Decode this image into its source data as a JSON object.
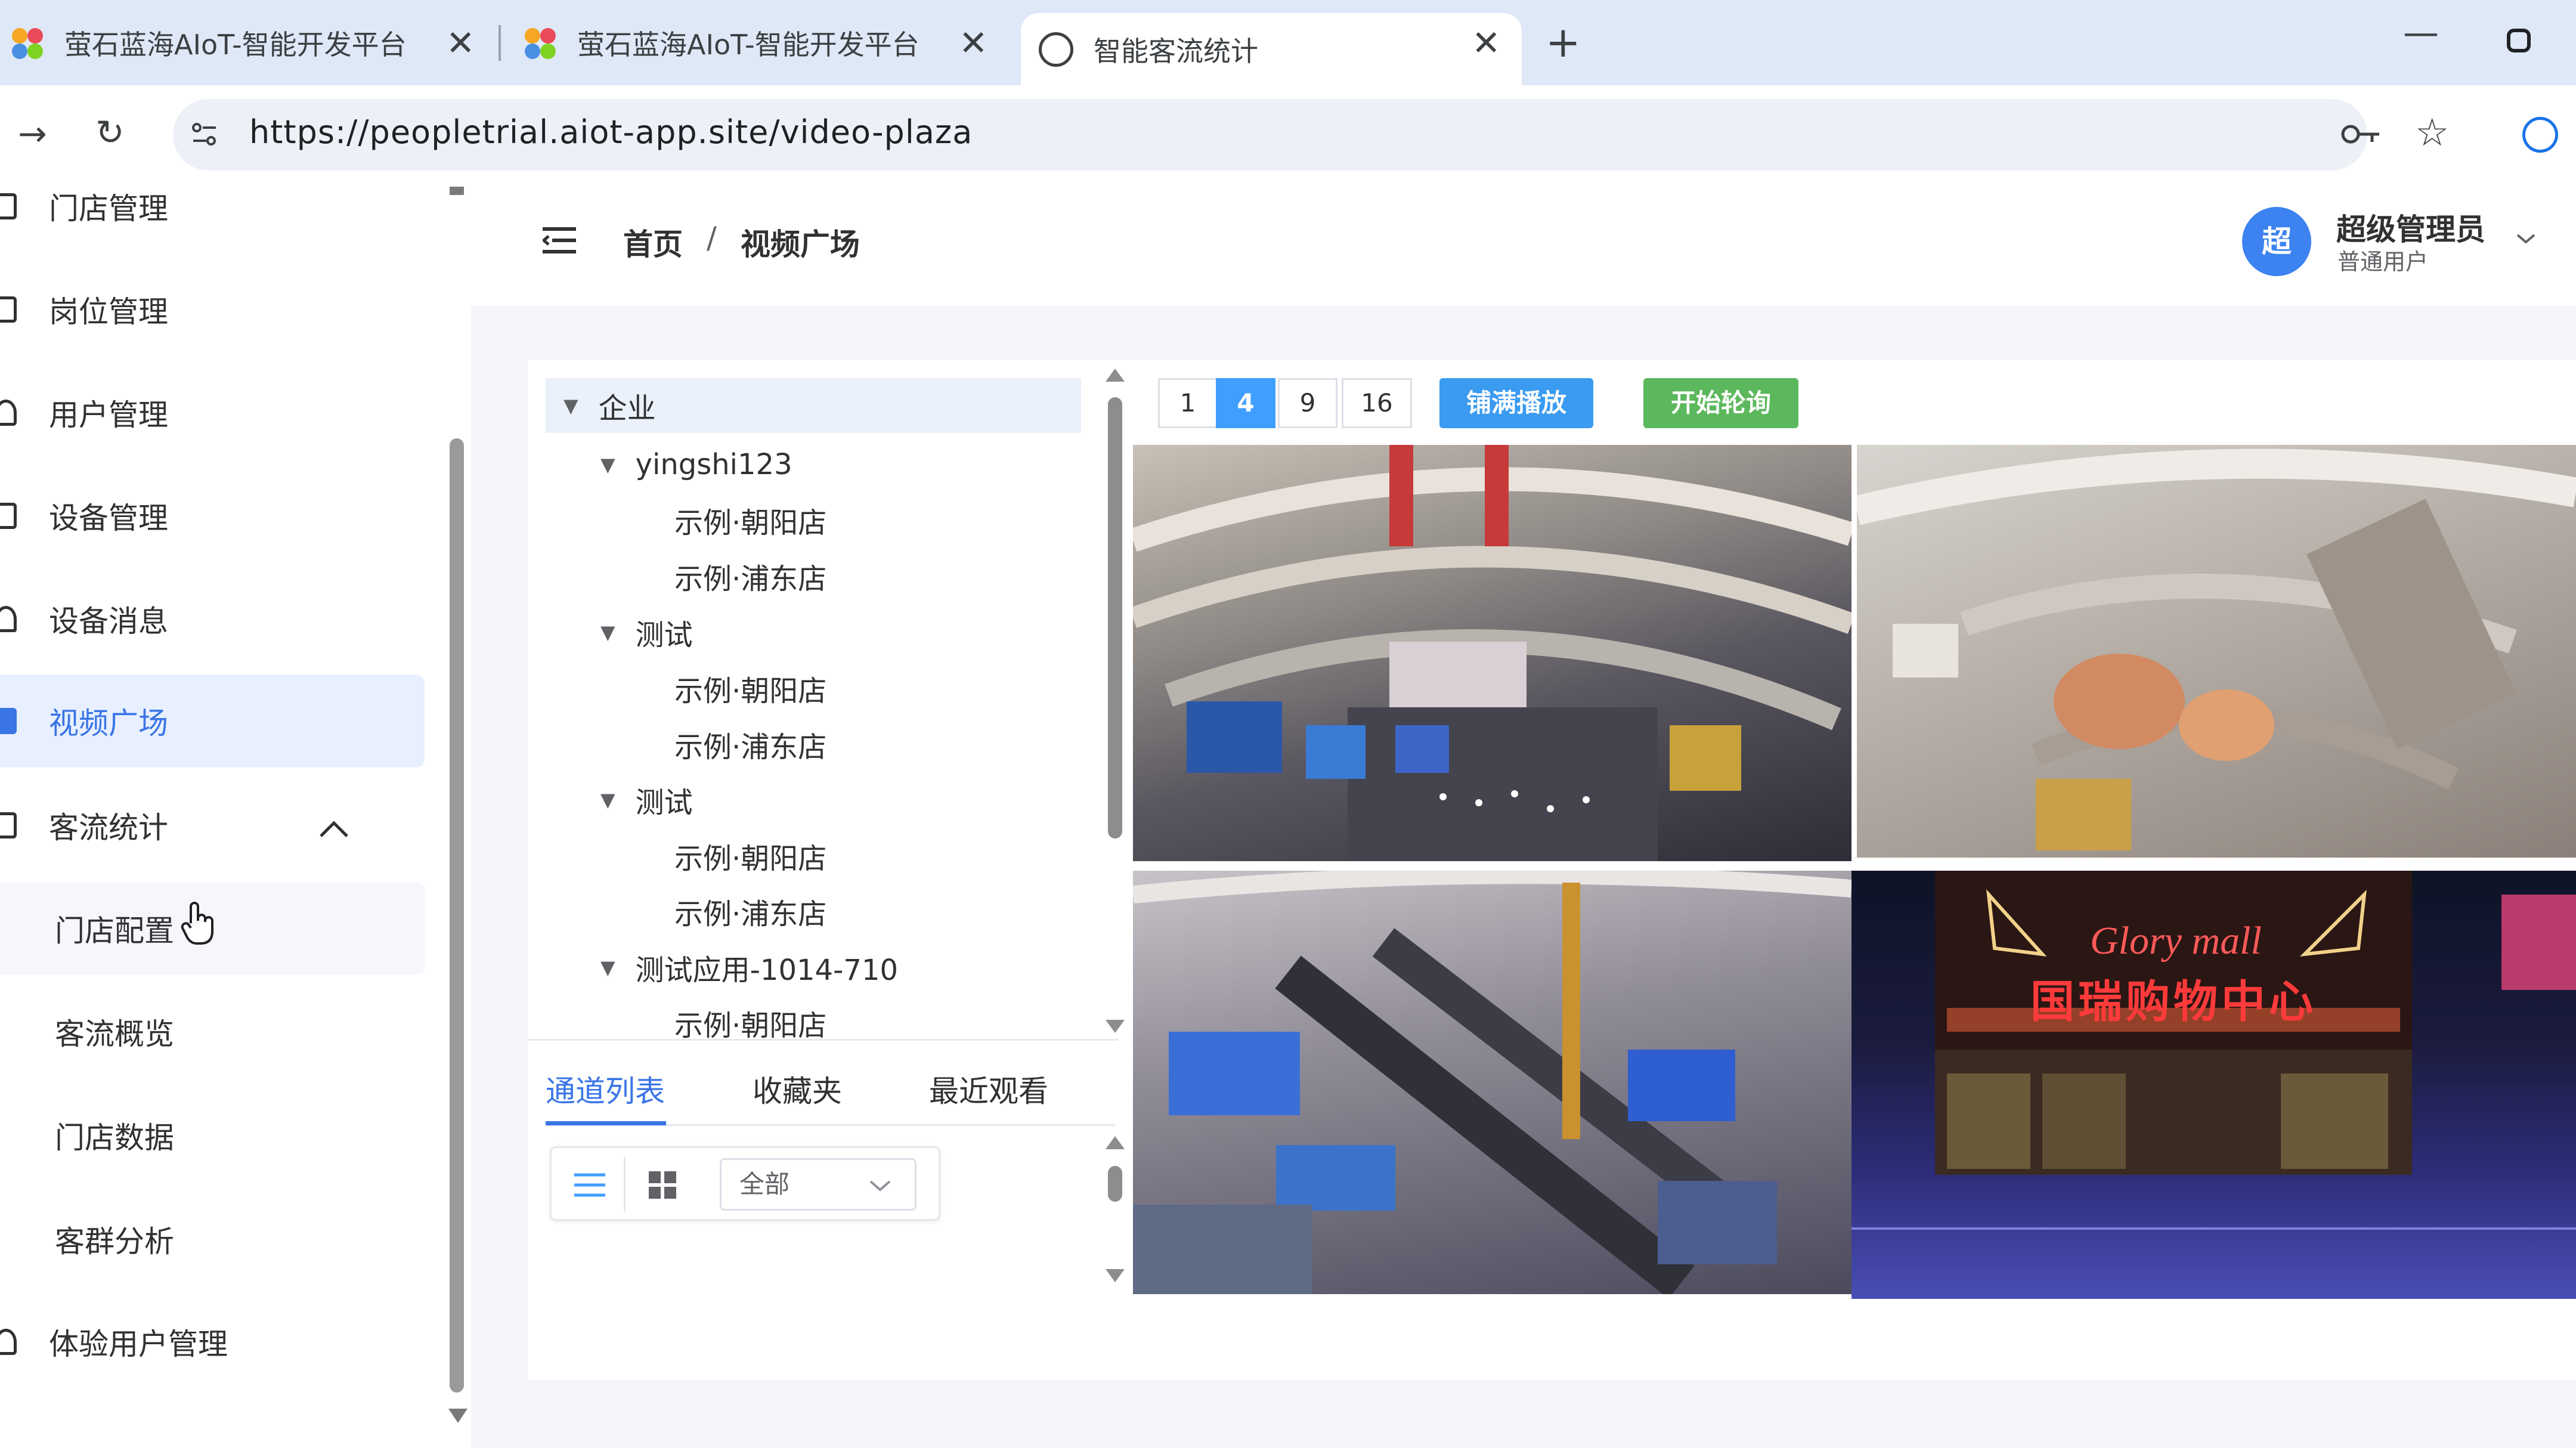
{
  "browser": {
    "tabs": [
      {
        "title": "萤石蓝海AIoT-智能开发平台"
      },
      {
        "title": "萤石蓝海AIoT-智能开发平台"
      },
      {
        "title": "智能客流统计"
      }
    ],
    "url": "https://peopletrial.aiot-app.site/video-plaza"
  },
  "sidebar": {
    "items": [
      {
        "label": "门店管理"
      },
      {
        "label": "岗位管理"
      },
      {
        "label": "用户管理"
      },
      {
        "label": "设备管理"
      },
      {
        "label": "设备消息"
      },
      {
        "label": "视频广场"
      },
      {
        "label": "客流统计"
      },
      {
        "label": "门店配置"
      },
      {
        "label": "客流概览"
      },
      {
        "label": "门店数据"
      },
      {
        "label": "客群分析"
      },
      {
        "label": "体验用户管理"
      }
    ]
  },
  "header": {
    "breadcrumb": {
      "home": "首页",
      "sep": "/",
      "current": "视频广场"
    },
    "avatar_text": "超",
    "user_name": "超级管理员",
    "user_role": "普通用户"
  },
  "tree": {
    "nodes": [
      {
        "label": "企业"
      },
      {
        "label": "yingshi123"
      },
      {
        "label": "示例·朝阳店"
      },
      {
        "label": "示例·浦东店"
      },
      {
        "label": "测试"
      },
      {
        "label": "示例·朝阳店"
      },
      {
        "label": "示例·浦东店"
      },
      {
        "label": "测试"
      },
      {
        "label": "示例·朝阳店"
      },
      {
        "label": "示例·浦东店"
      },
      {
        "label": "测试应用-1014-710"
      },
      {
        "label": "示例·朝阳店"
      }
    ]
  },
  "panel_tabs": {
    "channels": "通道列表",
    "favorites": "收藏夹",
    "recent": "最近观看"
  },
  "filter": {
    "selected": "全部"
  },
  "toolbar": {
    "paging": [
      "1",
      "4",
      "9",
      "16"
    ],
    "active_paging": "4",
    "fill_label": "铺满播放",
    "rotate_label": "开始轮询"
  },
  "videos": {
    "sign_text_1": "Glory mall",
    "sign_text_2": "国瑞购物中心"
  },
  "colors": {
    "accent": "#409eff",
    "primary_text": "#3a75e6",
    "green": "#67c23a"
  }
}
